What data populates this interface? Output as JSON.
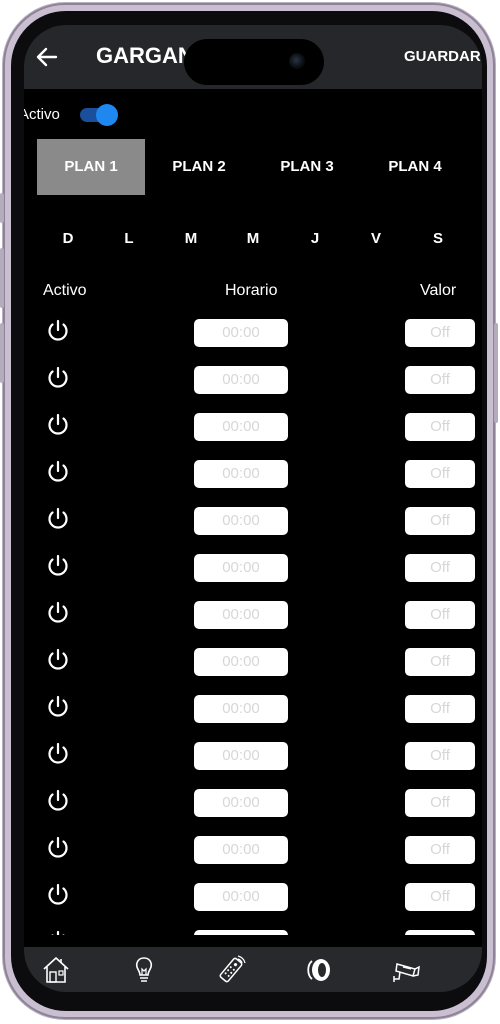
{
  "app_bar": {
    "title": "GARGANTA",
    "save_label": "GUARDAR"
  },
  "active": {
    "label": "Activo",
    "enabled": true
  },
  "plans": {
    "tabs": [
      "PLAN 1",
      "PLAN 2",
      "PLAN 3",
      "PLAN 4"
    ],
    "selected_index": 0
  },
  "days": [
    "D",
    "L",
    "M",
    "M",
    "J",
    "V",
    "S"
  ],
  "columns": {
    "active": "Activo",
    "schedule": "Horario",
    "value": "Valor"
  },
  "rows": [
    {
      "time_placeholder": "00:00",
      "value_placeholder": "Off"
    },
    {
      "time_placeholder": "00:00",
      "value_placeholder": "Off"
    },
    {
      "time_placeholder": "00:00",
      "value_placeholder": "Off"
    },
    {
      "time_placeholder": "00:00",
      "value_placeholder": "Off"
    },
    {
      "time_placeholder": "00:00",
      "value_placeholder": "Off"
    },
    {
      "time_placeholder": "00:00",
      "value_placeholder": "Off"
    },
    {
      "time_placeholder": "00:00",
      "value_placeholder": "Off"
    },
    {
      "time_placeholder": "00:00",
      "value_placeholder": "Off"
    },
    {
      "time_placeholder": "00:00",
      "value_placeholder": "Off"
    },
    {
      "time_placeholder": "00:00",
      "value_placeholder": "Off"
    },
    {
      "time_placeholder": "00:00",
      "value_placeholder": "Off"
    },
    {
      "time_placeholder": "00:00",
      "value_placeholder": "Off"
    },
    {
      "time_placeholder": "00:00",
      "value_placeholder": "Off"
    },
    {
      "time_placeholder": "",
      "value_placeholder": ""
    }
  ],
  "bottom_nav": [
    "home-icon",
    "lightbulb-icon",
    "remote-control-icon",
    "blind-icon",
    "security-camera-icon"
  ],
  "colors": {
    "accent": "#1e88f0",
    "app_bar": "#25272a",
    "selected_tab": "#8a8a8a",
    "background": "#000000"
  }
}
